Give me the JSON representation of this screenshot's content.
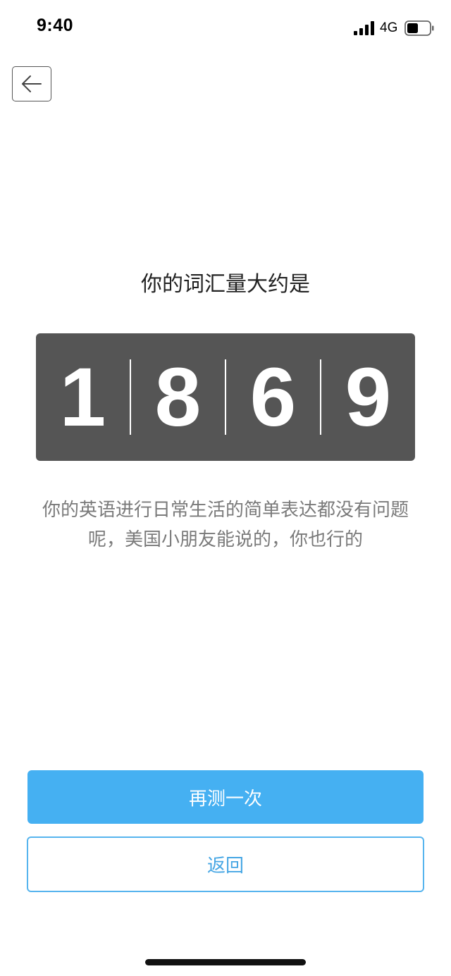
{
  "status_bar": {
    "time": "9:40",
    "network": "4G",
    "icons": [
      "signal-icon",
      "battery-icon"
    ]
  },
  "header": {
    "back_icon": "arrow-left-icon"
  },
  "result": {
    "title": "你的词汇量大约是",
    "digits": [
      "1",
      "8",
      "6",
      "9"
    ],
    "description": "你的英语进行日常生活的简单表达都没有问题呢，美国小朋友能说的，你也行的"
  },
  "actions": {
    "retry_label": "再测一次",
    "return_label": "返回"
  },
  "colors": {
    "counter_background": "#555555",
    "primary_button": "#45b0f2",
    "secondary_border": "#56b4ee",
    "secondary_text": "#45a6e4",
    "description_text": "#7a7a7a"
  }
}
